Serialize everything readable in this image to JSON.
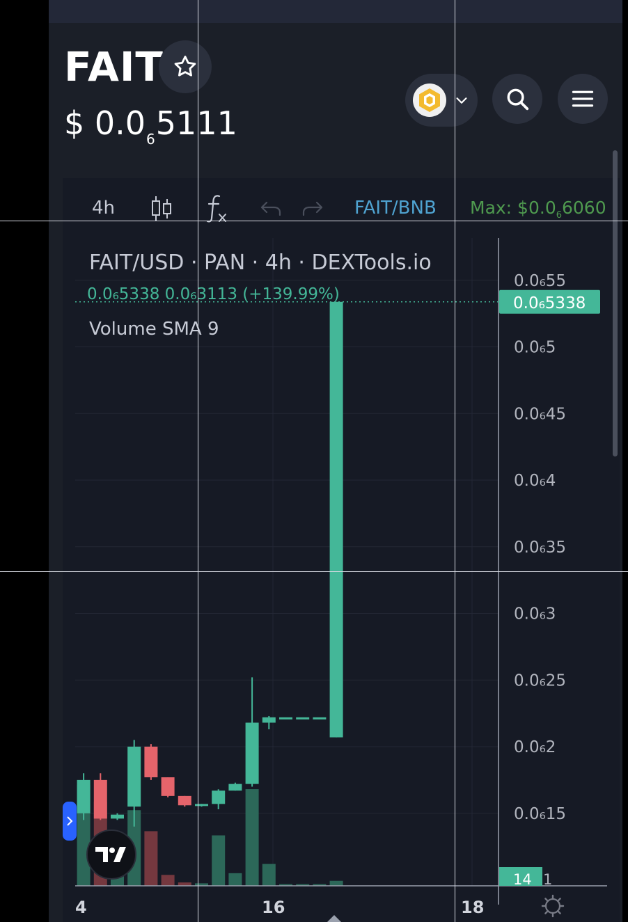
{
  "header": {
    "token_name": "FAIT",
    "price_prefix": "$ 0.0",
    "price_subscript": "6",
    "price_digits": "5111"
  },
  "icons": {
    "favorite": "star-icon",
    "chain": "bnb-chain-icon",
    "chain_dropdown": "chevron-down-icon",
    "search": "search-icon",
    "menu": "hamburger-menu-icon",
    "candles": "candlestick-icon",
    "indicators": "fx-indicators-icon",
    "undo": "undo-icon",
    "redo": "redo-icon",
    "chart_collapse": "chevron-right-icon",
    "tradingview_logo": "tradingview-logo-icon",
    "settings": "gear-icon"
  },
  "toolbar": {
    "interval": "4h",
    "pair": "FAIT/BNB",
    "max_label": "Max: $0.0",
    "max_sub": "6",
    "max_digits": "6060"
  },
  "legend": {
    "title": "FAIT/USD · PAN · 4h · DEXTools.io",
    "ohlc": "0.0₆5338  0.0₆3113 (+139.99%)",
    "volume": "Volume SMA 9"
  },
  "colors": {
    "background": "#161a25",
    "panel": "#1b1f28",
    "up": "#44b798",
    "down": "#e5646b",
    "pair_link": "#4fa3d1",
    "max": "#4f9a4f"
  },
  "chart_data": {
    "type": "candlestick",
    "unit_note": "prices in units of 1e-6 USD (0.0₆X notation)",
    "y_axis_labels": [
      "0.0₆55",
      "0.0₆5",
      "0.0₆45",
      "0.0₆4",
      "0.0₆35",
      "0.0₆3",
      "0.0₆25",
      "0.0₆2",
      "0.0₆15"
    ],
    "y_ticks": [
      0.55,
      0.5,
      0.45,
      0.4,
      0.35,
      0.3,
      0.25,
      0.2,
      0.15
    ],
    "x_axis_labels": [
      "4",
      "16",
      "18"
    ],
    "last_price_label": "0.0₆5338",
    "last_price": 0.5338,
    "volume_badge": "14",
    "volume_badge_tail": "1",
    "candles": [
      {
        "o": 0.15,
        "h": 0.18,
        "l": 0.145,
        "c": 0.175
      },
      {
        "o": 0.175,
        "h": 0.18,
        "l": 0.145,
        "c": 0.146
      },
      {
        "o": 0.146,
        "h": 0.15,
        "l": 0.145,
        "c": 0.149
      },
      {
        "o": 0.155,
        "h": 0.205,
        "l": 0.14,
        "c": 0.2
      },
      {
        "o": 0.2,
        "h": 0.202,
        "l": 0.175,
        "c": 0.177
      },
      {
        "o": 0.177,
        "h": 0.177,
        "l": 0.162,
        "c": 0.163
      },
      {
        "o": 0.163,
        "h": 0.163,
        "l": 0.155,
        "c": 0.156
      },
      {
        "o": 0.156,
        "h": 0.157,
        "l": 0.155,
        "c": 0.157
      },
      {
        "o": 0.157,
        "h": 0.168,
        "l": 0.153,
        "c": 0.167
      },
      {
        "o": 0.167,
        "h": 0.173,
        "l": 0.167,
        "c": 0.172
      },
      {
        "o": 0.172,
        "h": 0.252,
        "l": 0.17,
        "c": 0.218
      },
      {
        "o": 0.218,
        "h": 0.223,
        "l": 0.213,
        "c": 0.222
      },
      {
        "o": 0.222,
        "h": 0.222,
        "l": 0.222,
        "c": 0.222
      },
      {
        "o": 0.222,
        "h": 0.222,
        "l": 0.222,
        "c": 0.222
      },
      {
        "o": 0.222,
        "h": 0.222,
        "l": 0.222,
        "c": 0.222
      },
      {
        "o": 0.207,
        "h": 0.5338,
        "l": 0.207,
        "c": 0.5338
      }
    ],
    "volumes": [
      {
        "v": 12,
        "dir": "up"
      },
      {
        "v": 10,
        "dir": "down"
      },
      {
        "v": 6,
        "dir": "up"
      },
      {
        "v": 9,
        "dir": "up"
      },
      {
        "v": 6.5,
        "dir": "down"
      },
      {
        "v": 1.3,
        "dir": "down"
      },
      {
        "v": 0.4,
        "dir": "down"
      },
      {
        "v": 0.3,
        "dir": "up"
      },
      {
        "v": 6,
        "dir": "up"
      },
      {
        "v": 1.5,
        "dir": "up"
      },
      {
        "v": 11.5,
        "dir": "up"
      },
      {
        "v": 2.6,
        "dir": "up"
      },
      {
        "v": 0.2,
        "dir": "up"
      },
      {
        "v": 0.2,
        "dir": "up"
      },
      {
        "v": 0.2,
        "dir": "up"
      },
      {
        "v": 0.6,
        "dir": "up"
      }
    ]
  }
}
